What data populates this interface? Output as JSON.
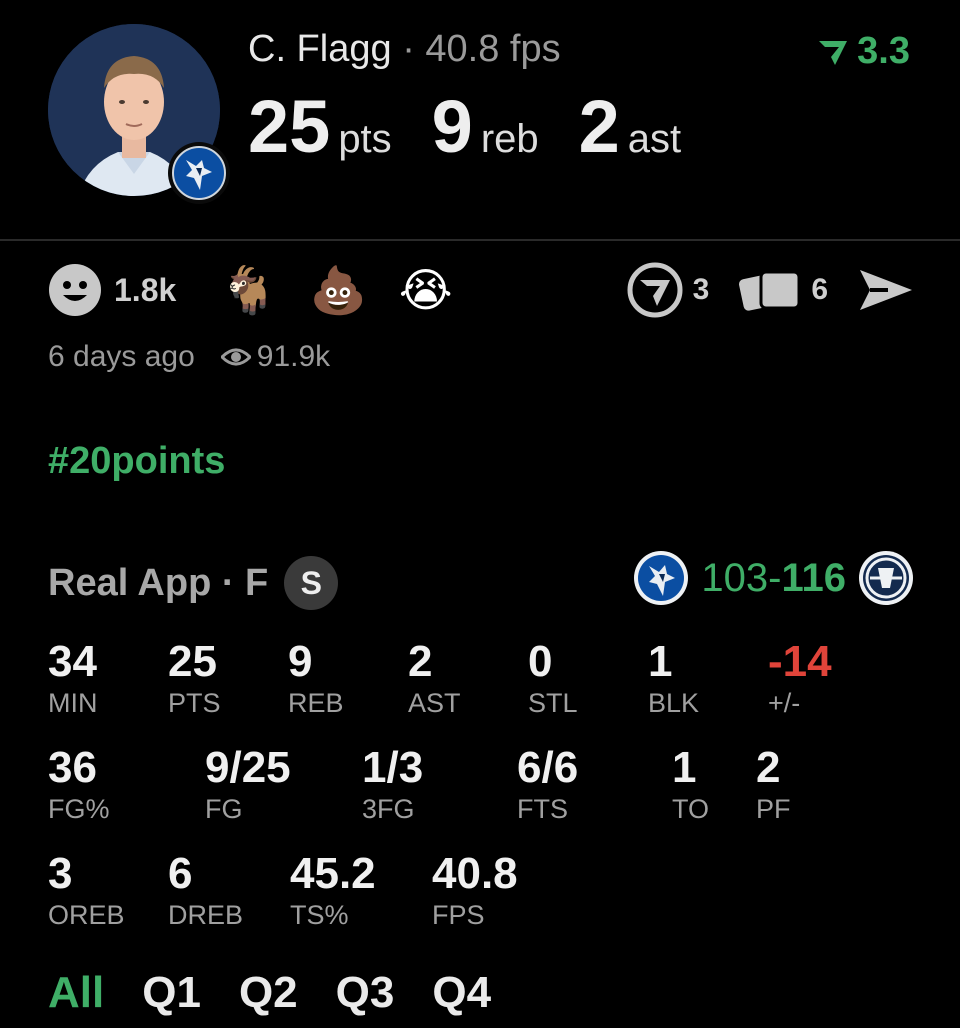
{
  "header": {
    "player_name": "C. Flagg",
    "separator": "·",
    "fps_text": "40.8 fps",
    "score_badge": "3.3",
    "colors": {
      "accent": "#3fae67",
      "negative": "#e0443a"
    }
  },
  "statline": [
    {
      "value": "25",
      "unit": "pts"
    },
    {
      "value": "9",
      "unit": "reb"
    },
    {
      "value": "2",
      "unit": "ast"
    }
  ],
  "reactions": {
    "smile_count": "1.8k",
    "emojis": [
      "goat-emoji",
      "poop-emoji",
      "crying-emoji"
    ],
    "comments_count": "3",
    "cards_count": "6"
  },
  "meta": {
    "posted": "6 days ago",
    "views": "91.9k"
  },
  "hashtag": "#20points",
  "game": {
    "source": "Real App · F",
    "badge": "S",
    "score_home": "103",
    "score_dash": "-",
    "score_away": "116"
  },
  "stats": {
    "row1": [
      {
        "value": "34",
        "label": "MIN"
      },
      {
        "value": "25",
        "label": "PTS"
      },
      {
        "value": "9",
        "label": "REB"
      },
      {
        "value": "2",
        "label": "AST"
      },
      {
        "value": "0",
        "label": "STL"
      },
      {
        "value": "1",
        "label": "BLK"
      },
      {
        "value": "-14",
        "label": "+/-"
      }
    ],
    "row2": [
      {
        "value": "36",
        "label": "FG%"
      },
      {
        "value": "9/25",
        "label": "FG"
      },
      {
        "value": "1/3",
        "label": "3FG"
      },
      {
        "value": "6/6",
        "label": "FTS"
      },
      {
        "value": "1",
        "label": "TO"
      },
      {
        "value": "2",
        "label": "PF"
      }
    ],
    "row3": [
      {
        "value": "3",
        "label": "OREB"
      },
      {
        "value": "6",
        "label": "DREB"
      },
      {
        "value": "45.2",
        "label": "TS%"
      },
      {
        "value": "40.8",
        "label": "FPS"
      }
    ]
  },
  "tabs": [
    "All",
    "Q1",
    "Q2",
    "Q3",
    "Q4"
  ]
}
